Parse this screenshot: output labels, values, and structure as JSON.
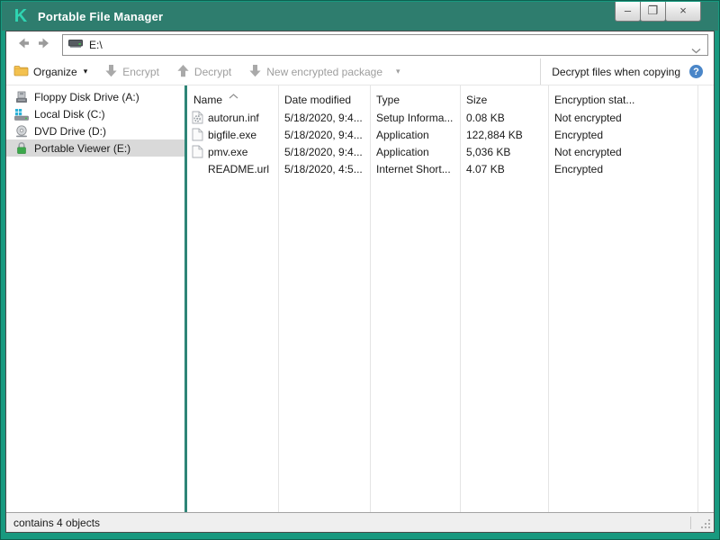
{
  "window": {
    "title": "Portable File Manager",
    "logo_glyph": "K",
    "controls": {
      "minimize": "–",
      "maximize": "❐",
      "close": "×"
    }
  },
  "navbar": {
    "address": "E:\\"
  },
  "toolbar": {
    "organize_label": "Organize",
    "encrypt_label": "Encrypt",
    "decrypt_label": "Decrypt",
    "new_package_label": "New encrypted package",
    "decrypt_copy_label": "Decrypt files when copying",
    "help_glyph": "?"
  },
  "sidebar": {
    "items": [
      {
        "label": "Floppy Disk Drive (A:)",
        "icon": "floppy-drive",
        "selected": false
      },
      {
        "label": "Local Disk (C:)",
        "icon": "hard-disk-drive",
        "selected": false
      },
      {
        "label": "DVD Drive (D:)",
        "icon": "dvd-drive",
        "selected": false
      },
      {
        "label": "Portable Viewer (E:)",
        "icon": "encrypted-drive-lock",
        "selected": true
      }
    ]
  },
  "filelist": {
    "columns": [
      "Name",
      "Date modified",
      "Type",
      "Size",
      "Encryption stat..."
    ],
    "sort": {
      "column": "Name",
      "direction": "ascending"
    },
    "rows": [
      {
        "icon": "setup-information-file",
        "name": "autorun.inf",
        "date_modified": "5/18/2020, 9:4...",
        "type": "Setup Informa...",
        "size": "0.08 KB",
        "encryption_status": "Not encrypted"
      },
      {
        "icon": "generic-file",
        "name": "bigfile.exe",
        "date_modified": "5/18/2020, 9:4...",
        "type": "Application",
        "size": "122,884 KB",
        "encryption_status": "Encrypted"
      },
      {
        "icon": "generic-file",
        "name": "pmv.exe",
        "date_modified": "5/18/2020, 9:4...",
        "type": "Application",
        "size": "5,036 KB",
        "encryption_status": "Not encrypted"
      },
      {
        "icon": "none",
        "name": "README.url",
        "date_modified": "5/18/2020, 4:5...",
        "type": "Internet Short...",
        "size": "4.07 KB",
        "encryption_status": "Encrypted"
      }
    ]
  },
  "statusbar": {
    "text": "contains 4 objects"
  },
  "colors": {
    "titlebar": "#2E7D6E",
    "window_border": "#18997F",
    "accent_divider": "#2E8577",
    "logo_mint": "#2FD5B2",
    "selected_row": "#D9D9D9",
    "help_blue": "#4A86C8",
    "disabled_text": "#9E9E9E",
    "lock_green": "#3CA84B"
  }
}
